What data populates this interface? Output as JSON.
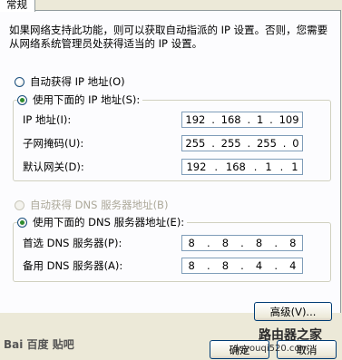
{
  "tab": {
    "label": "常规"
  },
  "description": "如果网络支持此功能，则可以获取自动指派的 IP 设置。否则，您需要从网络系统管理员处获得适当的 IP 设置。",
  "ip_section": {
    "auto_label": "自动获得 IP 地址(O)",
    "manual_label": "使用下面的 IP 地址(S):",
    "fields": [
      {
        "label": "IP 地址(I):",
        "octets": [
          "192",
          "168",
          "1",
          "109"
        ]
      },
      {
        "label": "子网掩码(U):",
        "octets": [
          "255",
          "255",
          "255",
          "0"
        ]
      },
      {
        "label": "默认网关(D):",
        "octets": [
          "192",
          "168",
          "1",
          "1"
        ]
      }
    ]
  },
  "dns_section": {
    "auto_label": "自动获得 DNS 服务器地址(B)",
    "manual_label": "使用下面的 DNS 服务器地址(E):",
    "fields": [
      {
        "label": "首选 DNS 服务器(P):",
        "octets": [
          "8",
          "8",
          "8",
          "8"
        ]
      },
      {
        "label": "备用 DNS 服务器(A):",
        "octets": [
          "8",
          "8",
          "4",
          "4"
        ]
      }
    ]
  },
  "buttons": {
    "advanced": "高级(V)...",
    "ok": "确定",
    "cancel": "取消"
  },
  "watermarks": {
    "baidu": "Bai 百度 贴吧",
    "site_cn": "路由器之家",
    "site_url": "luyouqi520.com"
  }
}
